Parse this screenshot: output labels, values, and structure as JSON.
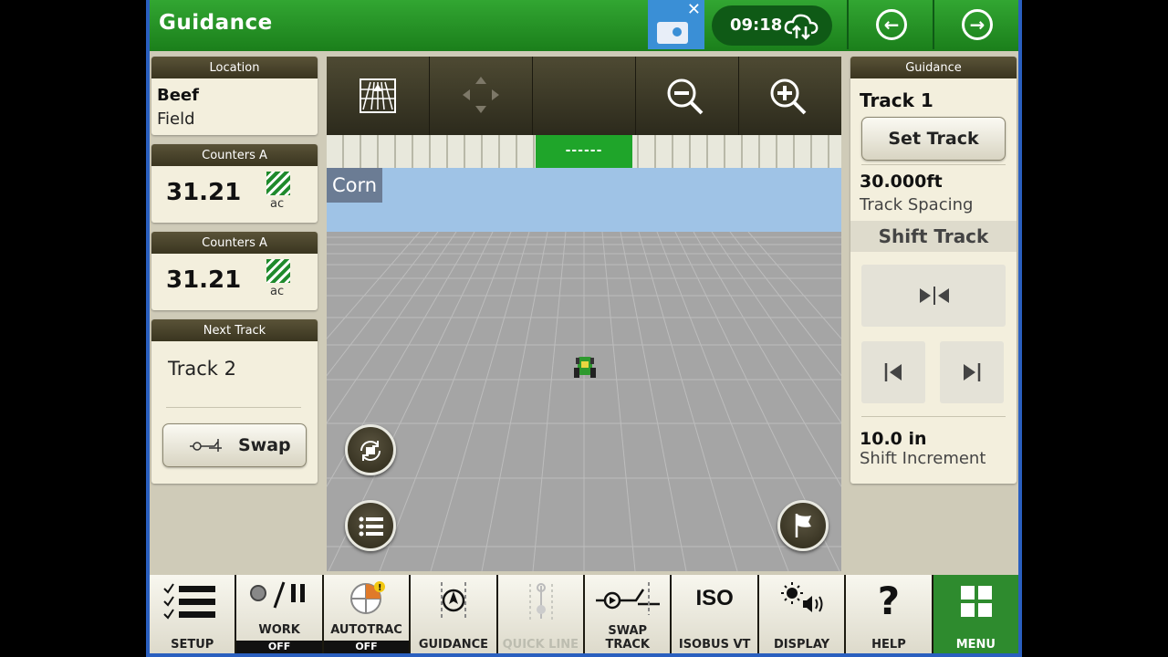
{
  "header": {
    "title": "Guidance",
    "time": "09:18"
  },
  "left": {
    "location": {
      "heading": "Location",
      "farm": "Beef",
      "field": "Field"
    },
    "counters": [
      {
        "heading": "Counters A",
        "value": "31.21",
        "unit": "ac"
      },
      {
        "heading": "Counters A",
        "value": "31.21",
        "unit": "ac"
      }
    ],
    "next_track": {
      "heading": "Next Track",
      "track": "Track 2",
      "swap_label": "Swap"
    }
  },
  "map": {
    "crop_label": "Corn",
    "lightbar_center": "------"
  },
  "right": {
    "heading": "Guidance",
    "track": "Track 1",
    "set_track_label": "Set Track",
    "spacing_value": "30.000ft",
    "spacing_label": "Track Spacing",
    "shift_heading": "Shift Track",
    "shift_value": "10.0 in",
    "shift_label": "Shift Increment"
  },
  "bottom": {
    "items": [
      {
        "label": "SETUP"
      },
      {
        "label": "WORK",
        "state": "OFF"
      },
      {
        "label": "AUTOTRAC",
        "state": "OFF"
      },
      {
        "label": "GUIDANCE"
      },
      {
        "label": "QUICK LINE"
      },
      {
        "label": "SWAP TRACK"
      },
      {
        "label": "ISOBUS VT",
        "badge": "ISO"
      },
      {
        "label": "DISPLAY"
      },
      {
        "label": "HELP",
        "glyph": "?"
      },
      {
        "label": "MENU"
      }
    ]
  },
  "colors": {
    "header_green": "#1b7f1b",
    "lightbar_active": "#1fa52a",
    "sky": "#9fc3e6",
    "ground": "#a5a5a5",
    "panel_bg": "#f3efdd"
  }
}
